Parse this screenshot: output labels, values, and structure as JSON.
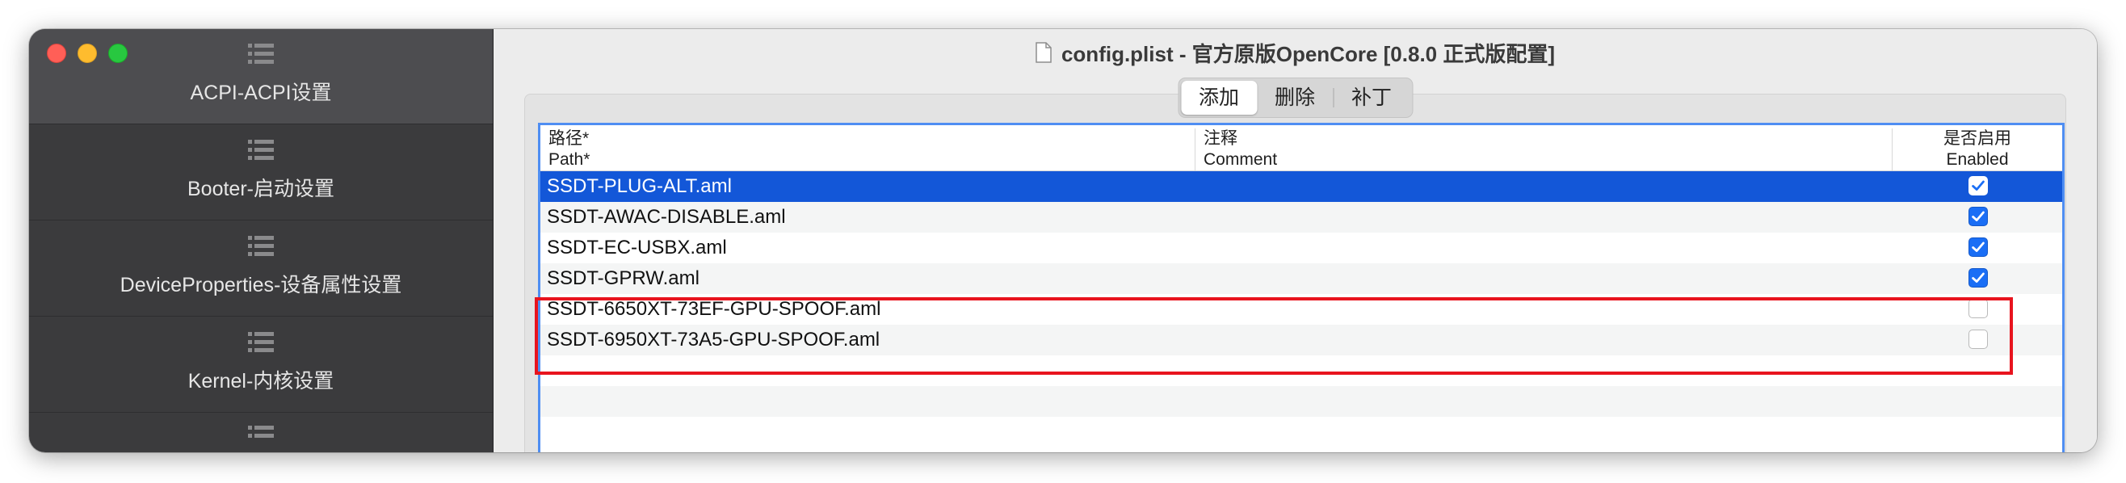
{
  "window": {
    "title": "config.plist - 官方原版OpenCore [0.8.0 正式版配置]"
  },
  "sidebar": {
    "items": [
      {
        "label": "ACPI-ACPI设置",
        "icon": "list-icon",
        "selected": true
      },
      {
        "label": "Booter-启动设置",
        "icon": "list-icon",
        "selected": false
      },
      {
        "label": "DeviceProperties-设备属性设置",
        "icon": "list-icon",
        "selected": false
      },
      {
        "label": "Kernel-内核设置",
        "icon": "list-icon",
        "selected": false
      }
    ]
  },
  "toolbar": {
    "segments": [
      "添加",
      "删除",
      "补丁"
    ],
    "active": "添加"
  },
  "table": {
    "headers": {
      "path_cn": "路径*",
      "path_en": "Path*",
      "comment_cn": "注释",
      "comment_en": "Comment",
      "enabled_cn": "是否启用",
      "enabled_en": "Enabled"
    },
    "rows": [
      {
        "path": "SSDT-PLUG-ALT.aml",
        "comment": "",
        "enabled": true,
        "selected": true
      },
      {
        "path": "SSDT-AWAC-DISABLE.aml",
        "comment": "",
        "enabled": true,
        "selected": false
      },
      {
        "path": "SSDT-EC-USBX.aml",
        "comment": "",
        "enabled": true,
        "selected": false
      },
      {
        "path": "SSDT-GPRW.aml",
        "comment": "",
        "enabled": true,
        "selected": false
      },
      {
        "path": "SSDT-6650XT-73EF-GPU-SPOOF.aml",
        "comment": "",
        "enabled": false,
        "selected": false
      },
      {
        "path": "SSDT-6950XT-73A5-GPU-SPOOF.aml",
        "comment": "",
        "enabled": false,
        "selected": false
      },
      {
        "path": "",
        "comment": "",
        "enabled": null,
        "selected": false
      },
      {
        "path": "",
        "comment": "",
        "enabled": null,
        "selected": false
      },
      {
        "path": "",
        "comment": "",
        "enabled": null,
        "selected": false
      }
    ]
  },
  "colors": {
    "selection": "#1357d8",
    "annotation": "#e8141e",
    "sidebar_bg": "#3b3b3d"
  }
}
